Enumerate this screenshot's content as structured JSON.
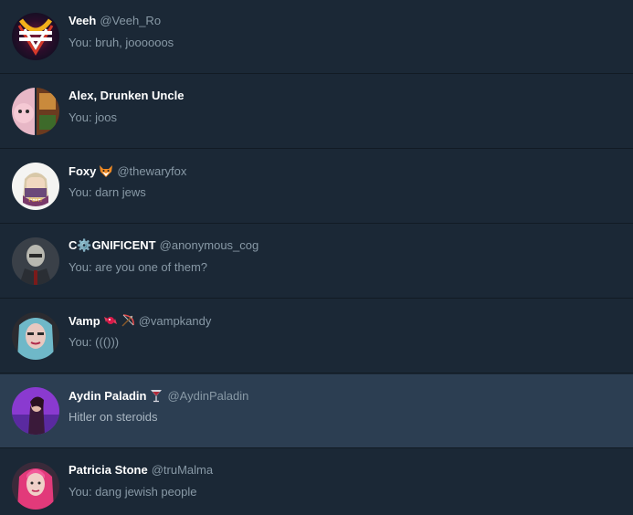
{
  "conversations": [
    {
      "name": "Veeh",
      "handle": "@Veeh_Ro",
      "preview": "You: bruh, joooooos",
      "emoji": "",
      "selected": false
    },
    {
      "name": "Alex, Drunken Uncle",
      "handle": "",
      "preview": "You: joos",
      "emoji": "",
      "selected": false
    },
    {
      "name": "Foxy",
      "handle": "@thewaryfox",
      "preview": "You: darn jews",
      "emoji": "fox-face-emoji",
      "selected": false
    },
    {
      "name": "C⚙️GNIFICENT",
      "handle": "@anonymous_cog",
      "preview": "You: are you one of them?",
      "emoji": "",
      "selected": false
    },
    {
      "name": "Vamp",
      "handle": "@vampkandy",
      "preview": "You: ((()))",
      "emoji": "candy-bow-emoji",
      "selected": false
    },
    {
      "name": "Aydin Paladin",
      "handle": "@AydinPaladin",
      "preview": "Hitler on steroids",
      "emoji": "cocktail-glass-emoji",
      "selected": true
    },
    {
      "name": "Patricia Stone",
      "handle": "@truMalma",
      "preview": "You: dang jewish people",
      "emoji": "",
      "selected": false
    }
  ],
  "colors": {
    "background": "#1b2836",
    "selected_background": "#2c3e52",
    "divider": "#121b24",
    "name": "#ffffff",
    "secondary_text": "#8899a6"
  }
}
